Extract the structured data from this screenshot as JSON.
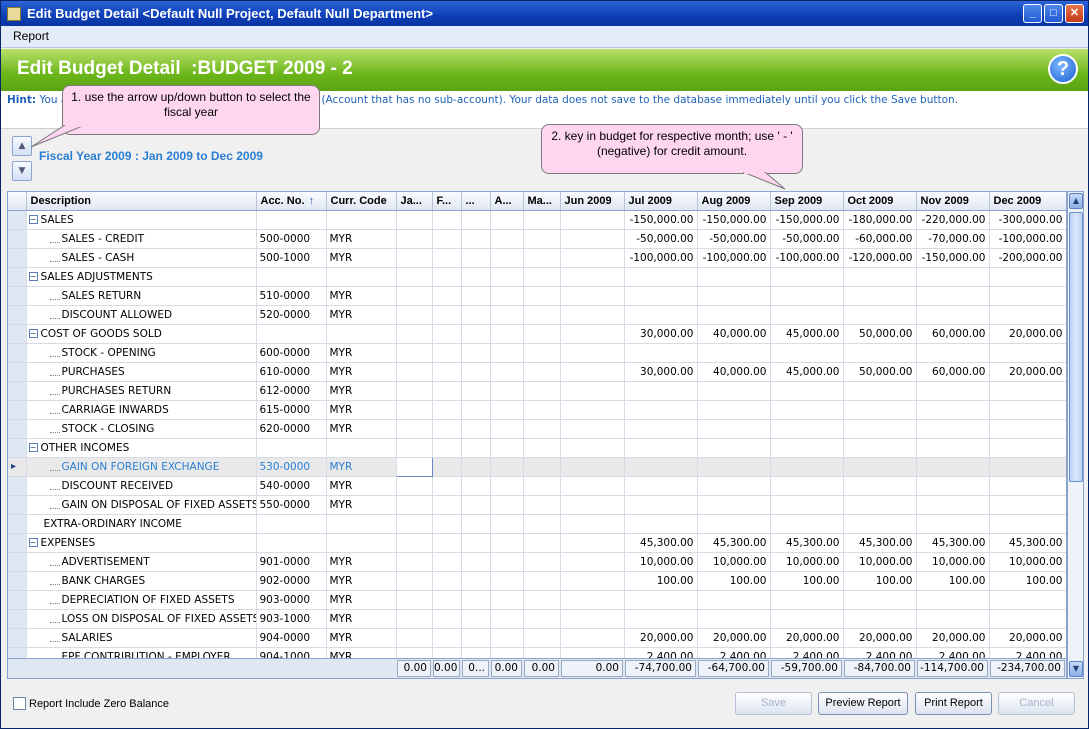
{
  "window": {
    "title": "Edit Budget Detail <Default Null Project, Default Null Department>"
  },
  "menu": {
    "report": "Report"
  },
  "banner": {
    "title": "Edit Budget Detail  :BUDGET 2009 - 2"
  },
  "hint": {
    "label": "Hint:",
    "text_start": "You a",
    "text_end": "t (Account that has no sub-account). Your data does not save to the database immediately until you click the Save button."
  },
  "callouts": {
    "c1": "1. use the arrow up/down button to select the fiscal year",
    "c2": "2. key in budget for respective month; use ' - ' (negative) for credit amount."
  },
  "fiscal_year": "Fiscal Year 2009 : Jan 2009 to Dec 2009",
  "columns": [
    "Description",
    "Acc. No.",
    "Curr. Code",
    "Ja...",
    "F...",
    "...",
    "A...",
    "Ma...",
    "Jun 2009",
    "Jul 2009",
    "Aug 2009",
    "Sep 2009",
    "Oct 2009",
    "Nov 2009",
    "Dec 2009"
  ],
  "sort_indicator": "↑",
  "rows": [
    {
      "type": "group",
      "desc": "SALES",
      "acc": "",
      "cur": "",
      "m": [
        "",
        "",
        "",
        "",
        "",
        "",
        "-150,000.00",
        "-150,000.00",
        "-150,000.00",
        "-180,000.00",
        "-220,000.00",
        "-300,000.00"
      ]
    },
    {
      "type": "leaf",
      "desc": "SALES - CREDIT",
      "acc": "500-0000",
      "cur": "MYR",
      "m": [
        "",
        "",
        "",
        "",
        "",
        "",
        "-50,000.00",
        "-50,000.00",
        "-50,000.00",
        "-60,000.00",
        "-70,000.00",
        "-100,000.00"
      ]
    },
    {
      "type": "leaf",
      "desc": "SALES - CASH",
      "acc": "500-1000",
      "cur": "MYR",
      "m": [
        "",
        "",
        "",
        "",
        "",
        "",
        "-100,000.00",
        "-100,000.00",
        "-100,000.00",
        "-120,000.00",
        "-150,000.00",
        "-200,000.00"
      ]
    },
    {
      "type": "group",
      "desc": "SALES ADJUSTMENTS",
      "acc": "",
      "cur": "",
      "m": [
        "",
        "",
        "",
        "",
        "",
        "",
        "",
        "",
        "",
        "",
        "",
        ""
      ]
    },
    {
      "type": "leaf",
      "desc": "SALES RETURN",
      "acc": "510-0000",
      "cur": "MYR",
      "m": [
        "",
        "",
        "",
        "",
        "",
        "",
        "",
        "",
        "",
        "",
        "",
        ""
      ]
    },
    {
      "type": "leaf",
      "desc": "DISCOUNT ALLOWED",
      "acc": "520-0000",
      "cur": "MYR",
      "m": [
        "",
        "",
        "",
        "",
        "",
        "",
        "",
        "",
        "",
        "",
        "",
        ""
      ]
    },
    {
      "type": "group",
      "desc": "COST OF GOODS SOLD",
      "acc": "",
      "cur": "",
      "m": [
        "",
        "",
        "",
        "",
        "",
        "",
        "30,000.00",
        "40,000.00",
        "45,000.00",
        "50,000.00",
        "60,000.00",
        "20,000.00"
      ]
    },
    {
      "type": "leaf",
      "desc": "STOCK - OPENING",
      "acc": "600-0000",
      "cur": "MYR",
      "m": [
        "",
        "",
        "",
        "",
        "",
        "",
        "",
        "",
        "",
        "",
        "",
        ""
      ]
    },
    {
      "type": "leaf",
      "desc": "PURCHASES",
      "acc": "610-0000",
      "cur": "MYR",
      "m": [
        "",
        "",
        "",
        "",
        "",
        "",
        "30,000.00",
        "40,000.00",
        "45,000.00",
        "50,000.00",
        "60,000.00",
        "20,000.00"
      ]
    },
    {
      "type": "leaf",
      "desc": "PURCHASES RETURN",
      "acc": "612-0000",
      "cur": "MYR",
      "m": [
        "",
        "",
        "",
        "",
        "",
        "",
        "",
        "",
        "",
        "",
        "",
        ""
      ]
    },
    {
      "type": "leaf",
      "desc": "CARRIAGE INWARDS",
      "acc": "615-0000",
      "cur": "MYR",
      "m": [
        "",
        "",
        "",
        "",
        "",
        "",
        "",
        "",
        "",
        "",
        "",
        ""
      ]
    },
    {
      "type": "leaf",
      "desc": "STOCK - CLOSING",
      "acc": "620-0000",
      "cur": "MYR",
      "m": [
        "",
        "",
        "",
        "",
        "",
        "",
        "",
        "",
        "",
        "",
        "",
        ""
      ]
    },
    {
      "type": "group",
      "desc": "OTHER INCOMES",
      "acc": "",
      "cur": "",
      "m": [
        "",
        "",
        "",
        "",
        "",
        "",
        "",
        "",
        "",
        "",
        "",
        ""
      ]
    },
    {
      "type": "leaf",
      "desc": "GAIN ON FOREIGN EXCHANGE",
      "acc": "530-0000",
      "cur": "MYR",
      "sel": true,
      "m": [
        "",
        "",
        "",
        "",
        "",
        "",
        "",
        "",
        "",
        "",
        "",
        ""
      ]
    },
    {
      "type": "leaf",
      "desc": "DISCOUNT RECEIVED",
      "acc": "540-0000",
      "cur": "MYR",
      "m": [
        "",
        "",
        "",
        "",
        "",
        "",
        "",
        "",
        "",
        "",
        "",
        ""
      ]
    },
    {
      "type": "leaf",
      "desc": "GAIN ON DISPOSAL OF FIXED ASSETS",
      "acc": "550-0000",
      "cur": "MYR",
      "m": [
        "",
        "",
        "",
        "",
        "",
        "",
        "",
        "",
        "",
        "",
        "",
        ""
      ]
    },
    {
      "type": "plain",
      "desc": "EXTRA-ORDINARY INCOME",
      "acc": "",
      "cur": "",
      "m": [
        "",
        "",
        "",
        "",
        "",
        "",
        "",
        "",
        "",
        "",
        "",
        ""
      ]
    },
    {
      "type": "group",
      "desc": "EXPENSES",
      "acc": "",
      "cur": "",
      "m": [
        "",
        "",
        "",
        "",
        "",
        "",
        "45,300.00",
        "45,300.00",
        "45,300.00",
        "45,300.00",
        "45,300.00",
        "45,300.00"
      ]
    },
    {
      "type": "leaf",
      "desc": "ADVERTISEMENT",
      "acc": "901-0000",
      "cur": "MYR",
      "m": [
        "",
        "",
        "",
        "",
        "",
        "",
        "10,000.00",
        "10,000.00",
        "10,000.00",
        "10,000.00",
        "10,000.00",
        "10,000.00"
      ]
    },
    {
      "type": "leaf",
      "desc": "BANK CHARGES",
      "acc": "902-0000",
      "cur": "MYR",
      "m": [
        "",
        "",
        "",
        "",
        "",
        "",
        "100.00",
        "100.00",
        "100.00",
        "100.00",
        "100.00",
        "100.00"
      ]
    },
    {
      "type": "leaf",
      "desc": "DEPRECIATION OF FIXED ASSETS",
      "acc": "903-0000",
      "cur": "MYR",
      "m": [
        "",
        "",
        "",
        "",
        "",
        "",
        "",
        "",
        "",
        "",
        "",
        ""
      ]
    },
    {
      "type": "leaf",
      "desc": "LOSS ON DISPOSAL OF FIXED ASSETS",
      "acc": "903-1000",
      "cur": "MYR",
      "m": [
        "",
        "",
        "",
        "",
        "",
        "",
        "",
        "",
        "",
        "",
        "",
        ""
      ]
    },
    {
      "type": "leaf",
      "desc": "SALARIES",
      "acc": "904-0000",
      "cur": "MYR",
      "m": [
        "",
        "",
        "",
        "",
        "",
        "",
        "20,000.00",
        "20,000.00",
        "20,000.00",
        "20,000.00",
        "20,000.00",
        "20,000.00"
      ]
    },
    {
      "type": "leaf",
      "desc": "EPF CONTRIBUTION - EMPLOYER",
      "acc": "904-1000",
      "cur": "MYR",
      "m": [
        "",
        "",
        "",
        "",
        "",
        "",
        "2,400.00",
        "2,400.00",
        "2,400.00",
        "2,400.00",
        "2,400.00",
        "2,400.00"
      ]
    }
  ],
  "totals": [
    "0.00",
    "0.00",
    "0...",
    "0.00",
    "0.00",
    "0.00",
    "-74,700.00",
    "-64,700.00",
    "-59,700.00",
    "-84,700.00",
    "-114,700.00",
    "-234,700.00"
  ],
  "footer": {
    "checkbox_label": "Report Include Zero Balance",
    "save": "Save",
    "preview": "Preview Report",
    "print": "Print Report",
    "cancel": "Cancel"
  }
}
